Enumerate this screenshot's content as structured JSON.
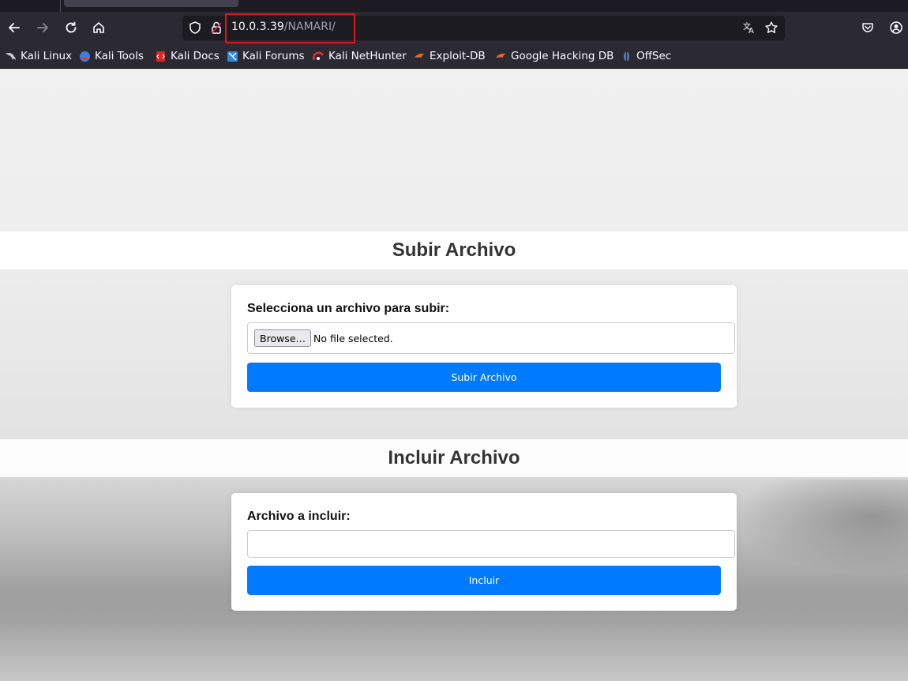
{
  "browser": {
    "url_host": "10.0.3.39",
    "url_path": "/NAMARI/",
    "bookmarks": [
      {
        "label": "Kali Linux",
        "icon": "kali-dragon-icon",
        "color": "#c9c9c9"
      },
      {
        "label": "Kali Tools",
        "icon": "kali-tools-icon",
        "color": "#3d7fe0"
      },
      {
        "label": "Kali Docs",
        "icon": "kali-docs-icon",
        "color": "#d9261c"
      },
      {
        "label": "Kali Forums",
        "icon": "kali-forums-icon",
        "color": "#2f86e0"
      },
      {
        "label": "Kali NetHunter",
        "icon": "kali-nethunter-icon",
        "color": "#e0302f"
      },
      {
        "label": "Exploit-DB",
        "icon": "exploit-db-icon",
        "color": "#e8672b"
      },
      {
        "label": "Google Hacking DB",
        "icon": "ghdb-icon",
        "color": "#e8672b"
      },
      {
        "label": "OffSec",
        "icon": "offsec-icon",
        "color": "#5b7fd6"
      }
    ]
  },
  "upload_section": {
    "title": "Subir Archivo",
    "label": "Selecciona un archivo para subir:",
    "browse_label": "Browse…",
    "no_file_text": "No file selected.",
    "submit_label": "Subir Archivo"
  },
  "include_section": {
    "title": "Incluir Archivo",
    "label": "Archivo a incluir:",
    "input_value": "",
    "submit_label": "Incluir"
  },
  "colors": {
    "primary_button": "#007bff",
    "url_highlight": "#e0141b"
  }
}
